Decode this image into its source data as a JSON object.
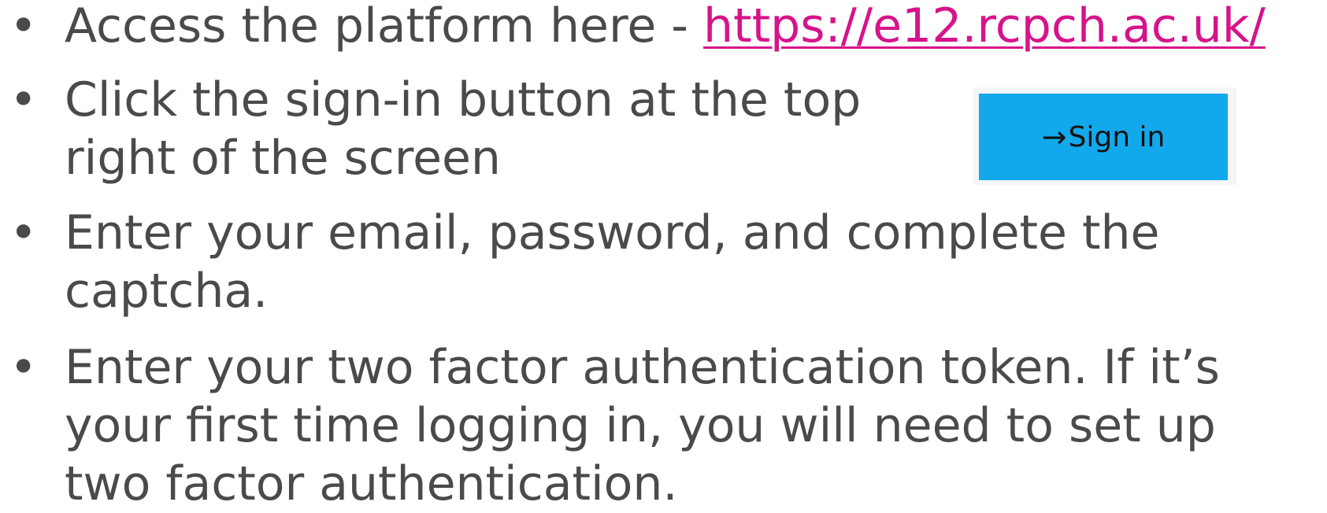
{
  "bullets": {
    "symbol": "•",
    "item1": {
      "text": "Access the platform here - ",
      "link": "https://e12.rcpch.ac.uk/"
    },
    "item2": {
      "line1": "Click the sign-in button at the top",
      "line2": "right of the screen"
    },
    "item3": {
      "line1": "Enter your email, password, and complete the",
      "line2": "captcha."
    },
    "item4": {
      "line1": "Enter your two factor authentication token. If it’s",
      "line2": "your first time logging in, you will need to set up",
      "line3": "two factor authentication."
    }
  },
  "signin_button": {
    "icon": "→",
    "label": "Sign in"
  },
  "colors": {
    "text": "#4a4a4a",
    "link": "#d6138a",
    "button": "#12a9ec"
  }
}
